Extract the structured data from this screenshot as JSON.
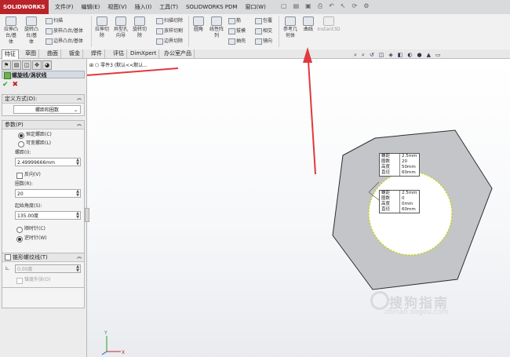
{
  "app": {
    "logo_text": "SOLIDWORKS"
  },
  "menu": [
    "文件(F)",
    "编辑(E)",
    "视图(V)",
    "插入(I)",
    "工具(T)",
    "SOLIDWORKS PDM",
    "窗口(W)"
  ],
  "ribbon": {
    "extrude_boss": "拉伸凸\n台/基\n体",
    "revolve_boss": "旋转凸\n台/基\n体",
    "sweep": "扫描",
    "loft": "放样凸台/基体",
    "boundary_boss": "边界凸台/基体",
    "extrude_cut": "拉伸切\n除",
    "hole_wizard": "异型孔\n向导",
    "revolve_cut": "旋转切\n除",
    "swept_cut": "扫描切除",
    "lofted_cut": "放样切割",
    "boundary_cut": "边界切除",
    "fillet": "圆角",
    "linear_pattern": "线性阵\n列",
    "rib": "筋",
    "draft": "拔模",
    "shell": "抽壳",
    "wrap": "包覆",
    "intersect": "相交",
    "mirror": "镜向",
    "ref_geometry": "参考几\n何体",
    "curves": "曲线",
    "instant3d": "Instant3D"
  },
  "tabs": [
    "特征",
    "草图",
    "曲面",
    "钣金",
    "焊件",
    "评估",
    "DimXpert",
    "办公室产品"
  ],
  "tree_line": "零件3 (默认<<默认...",
  "panel": {
    "title": "螺旋线/涡状线",
    "define_by_header": "定义方式(D):",
    "define_by_value": "螺距和圈数",
    "params_header": "参数(P)",
    "constant_pitch": "恒定螺距(C)",
    "variable_pitch": "可变螺距(L)",
    "pitch_label": "螺距(I):",
    "pitch_value": "2.49999666mm",
    "reverse": "反向(V)",
    "revolutions_label": "圈数(R):",
    "revolutions_value": "20",
    "start_angle_label": "起始角度(S):",
    "start_angle_value": "135.00度",
    "clockwise": "顺时针(C)",
    "counterclockwise": "逆时针(W)",
    "taper_header": "锥形螺纹线(T)",
    "taper_value": "0.00度",
    "taper_outward": "锥度外张(O)"
  },
  "callout_top": [
    [
      "螺距",
      "2.5mm"
    ],
    [
      "圈数",
      "20"
    ],
    [
      "高度",
      "50mm"
    ],
    [
      "直径",
      "60mm"
    ]
  ],
  "callout_bottom": [
    [
      "螺距",
      "2.5mm"
    ],
    [
      "圈数",
      "0"
    ],
    [
      "高度",
      "0mm"
    ],
    [
      "直径",
      "60mm"
    ]
  ],
  "watermark": {
    "brand": "搜狗指南",
    "url": "zhinan.sogou.com"
  },
  "colors": {
    "logo_bg": "#b8242a",
    "arrow": "#e0393e",
    "helix": "#c8d400"
  }
}
